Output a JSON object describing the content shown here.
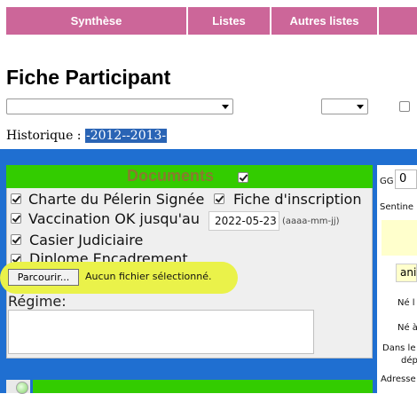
{
  "nav": {
    "items": [
      {
        "label": "Synthèse"
      },
      {
        "label": "Listes"
      },
      {
        "label": "Autres listes"
      }
    ]
  },
  "page": {
    "title": "Fiche Participant"
  },
  "historique": {
    "label": "Historique :",
    "year": "-2012--2013-"
  },
  "documents": {
    "title": "Documents",
    "items": [
      {
        "label": "Charte du Pélerin Signée",
        "checked": true
      },
      {
        "label": "Fiche d'inscription",
        "checked": true
      },
      {
        "label": "Vaccination OK jusqu'au",
        "checked": true,
        "date": "2022-05-23",
        "date_hint": "(aaaa-mm-jj)"
      },
      {
        "label": "Casier Judiciaire",
        "checked": true
      },
      {
        "label": "Diplome Encadrement",
        "checked": true
      }
    ],
    "browse_label": "Parcourir...",
    "nofile_label": "Aucun fichier sélectionné.",
    "regime_label": "Régime:",
    "regime_value": ""
  },
  "right": {
    "gg_label": "GG",
    "gg_value": "0",
    "sentine_label": "Sentine",
    "ani_label": "ani",
    "ne_l": "Né l",
    "ne_a": "Né à",
    "dans_le": "Dans le",
    "dep": "dép",
    "adresse": "Adresse"
  },
  "colors": {
    "nav": "#cc6699",
    "blue": "#1f6fd1",
    "green": "#33cc00",
    "highlight": "#eaf24a"
  }
}
